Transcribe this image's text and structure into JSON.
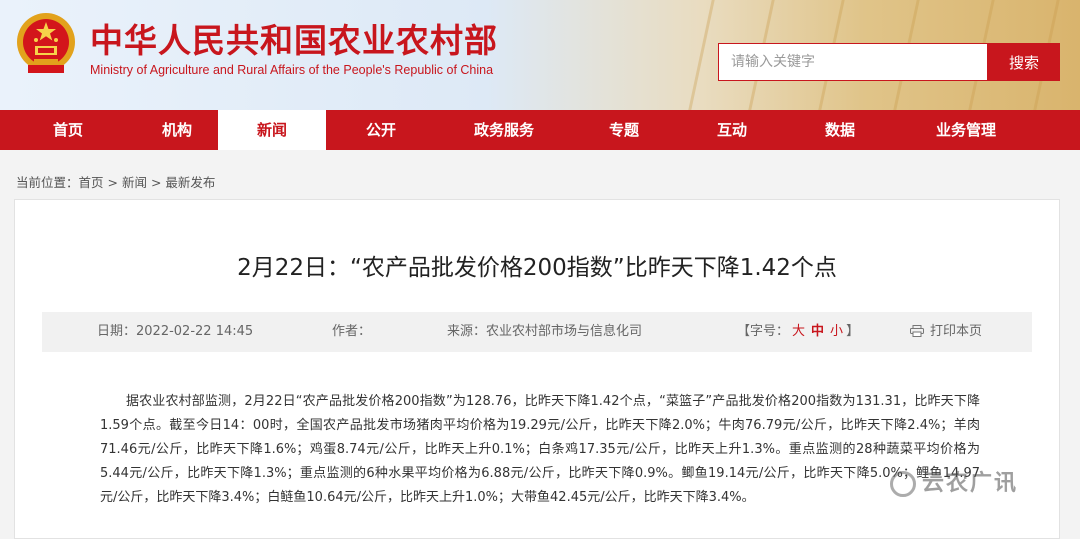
{
  "header": {
    "title_cn": "中华人民共和国农业农村部",
    "title_en": "Ministry of Agriculture and Rural Affairs of the People's Republic of China",
    "emblem_icon": "national-emblem-icon",
    "brand_color": "#c8161d"
  },
  "search": {
    "placeholder": "请输入关键字",
    "button_label": "搜索"
  },
  "nav": {
    "items": [
      {
        "label": "首页"
      },
      {
        "label": "机构"
      },
      {
        "label": "新闻",
        "active": true
      },
      {
        "label": "公开"
      },
      {
        "label": "政务服务"
      },
      {
        "label": "专题"
      },
      {
        "label": "互动"
      },
      {
        "label": "数据"
      },
      {
        "label": "业务管理"
      }
    ]
  },
  "breadcrumb": {
    "prefix": "当前位置：",
    "items": [
      "首页",
      "新闻",
      "最新发布"
    ],
    "separator": " > "
  },
  "article": {
    "title": "2月22日：“农产品批发价格200指数”比昨天下降1.42个点",
    "meta": {
      "date_label": "日期：",
      "date": "2022-02-22 14:45",
      "author_label": "作者：",
      "source_label": "来源：",
      "source": "农业农村部市场与信息化司",
      "font_label": "【字号：",
      "font_large": "大",
      "font_mid": "中",
      "font_small": "小",
      "font_end": "】",
      "print_label": "打印本页",
      "print_icon": "printer-icon"
    },
    "body": "据农业农村部监测，2月22日“农产品批发价格200指数”为128.76，比昨天下降1.42个点，“菜篮子”产品批发价格200指数为131.31，比昨天下降1.59个点。截至今日14：00时，全国农产品批发市场猪肉平均价格为19.29元/公斤，比昨天下降2.0%；牛肉76.79元/公斤，比昨天下降2.4%；羊肉71.46元/公斤，比昨天下降1.6%；鸡蛋8.74元/公斤，比昨天上升0.1%；白条鸡17.35元/公斤，比昨天上升1.3%。重点监测的28种蔬菜平均价格为5.44元/公斤，比昨天下降1.3%；重点监测的6种水果平均价格为6.88元/公斤，比昨天下降0.9%。鲫鱼19.14元/公斤，比昨天下降5.0%；鲤鱼14.97元/公斤，比昨天下降3.4%；白鲢鱼10.64元/公斤，比昨天上升1.0%；大带鱼42.45元/公斤，比昨天下降3.4%。"
  },
  "watermark": {
    "text": "云农广讯",
    "icon": "wechat-logo-icon"
  }
}
